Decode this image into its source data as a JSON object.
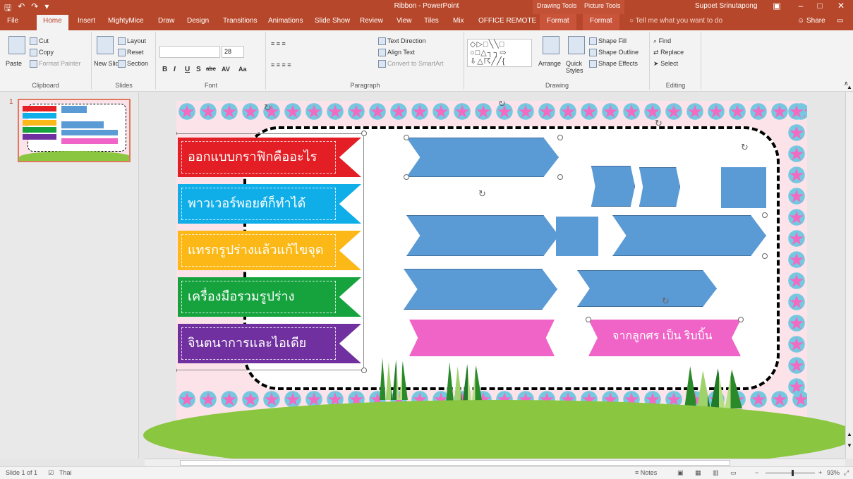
{
  "window": {
    "title": "Ribbon - PowerPoint",
    "drawing_tools": "Drawing Tools",
    "picture_tools": "Picture Tools",
    "user": "Supoet Srinutapong",
    "qat_icons": [
      "save-icon",
      "undo-icon",
      "redo-icon",
      "customize-icon"
    ]
  },
  "tabs": [
    "File",
    "Home",
    "Insert",
    "MightyMice",
    "Draw",
    "Design",
    "Transitions",
    "Animations",
    "Slide Show",
    "Review",
    "View",
    "Tiles",
    "Mix",
    "OFFICE REMOTE"
  ],
  "context_tabs": [
    "Format",
    "Format"
  ],
  "tell_me": "Tell me what you want to do",
  "share": "Share",
  "ribbon": {
    "clipboard": {
      "paste": "Paste",
      "cut": "Cut",
      "copy": "Copy",
      "format_painter": "Format Painter",
      "label": "Clipboard"
    },
    "slides": {
      "new_slide": "New Slide",
      "layout": "Layout",
      "reset": "Reset",
      "section": "Section",
      "label": "Slides"
    },
    "font": {
      "size": "28",
      "bold": "B",
      "italic": "I",
      "underline": "U",
      "shadow": "S",
      "strike": "abc",
      "spacing": "AV",
      "case": "Aa",
      "label": "Font"
    },
    "paragraph": {
      "text_direction": "Text Direction",
      "align_text": "Align Text",
      "convert_smartart": "Convert to SmartArt",
      "label": "Paragraph"
    },
    "drawing": {
      "arrange": "Arrange",
      "quick_styles": "Quick Styles",
      "shape_fill": "Shape Fill",
      "shape_outline": "Shape Outline",
      "shape_effects": "Shape Effects",
      "label": "Drawing"
    },
    "editing": {
      "find": "Find",
      "replace": "Replace",
      "select": "Select",
      "label": "Editing"
    }
  },
  "thumbnail": {
    "number": "1"
  },
  "slide": {
    "ribbons": [
      {
        "text": "ออกแบบกราฟิกคืออะไร",
        "color": "#e31e24"
      },
      {
        "text": "พาวเวอร์พอยต์ก็ทำได้",
        "color": "#10aee8"
      },
      {
        "text": "แทรกรูปร่างแล้วแก้ไขจุด",
        "color": "#fbb816"
      },
      {
        "text": "เครื่องมือรวมรูปร่าง",
        "color": "#16a33e"
      },
      {
        "text": "จินตนาการและไอเดีย",
        "color": "#70309f"
      }
    ],
    "pink_ribbon_right": "จากลูกศร เป็น ริบบิ้น",
    "colors": {
      "blue_shape": "#5b9bd5",
      "pink_ribbon": "#f064c7",
      "ground": "#8ac63f"
    }
  },
  "status": {
    "slide": "Slide 1 of 1",
    "language": "Thai",
    "notes": "Notes",
    "zoom": "93%"
  }
}
